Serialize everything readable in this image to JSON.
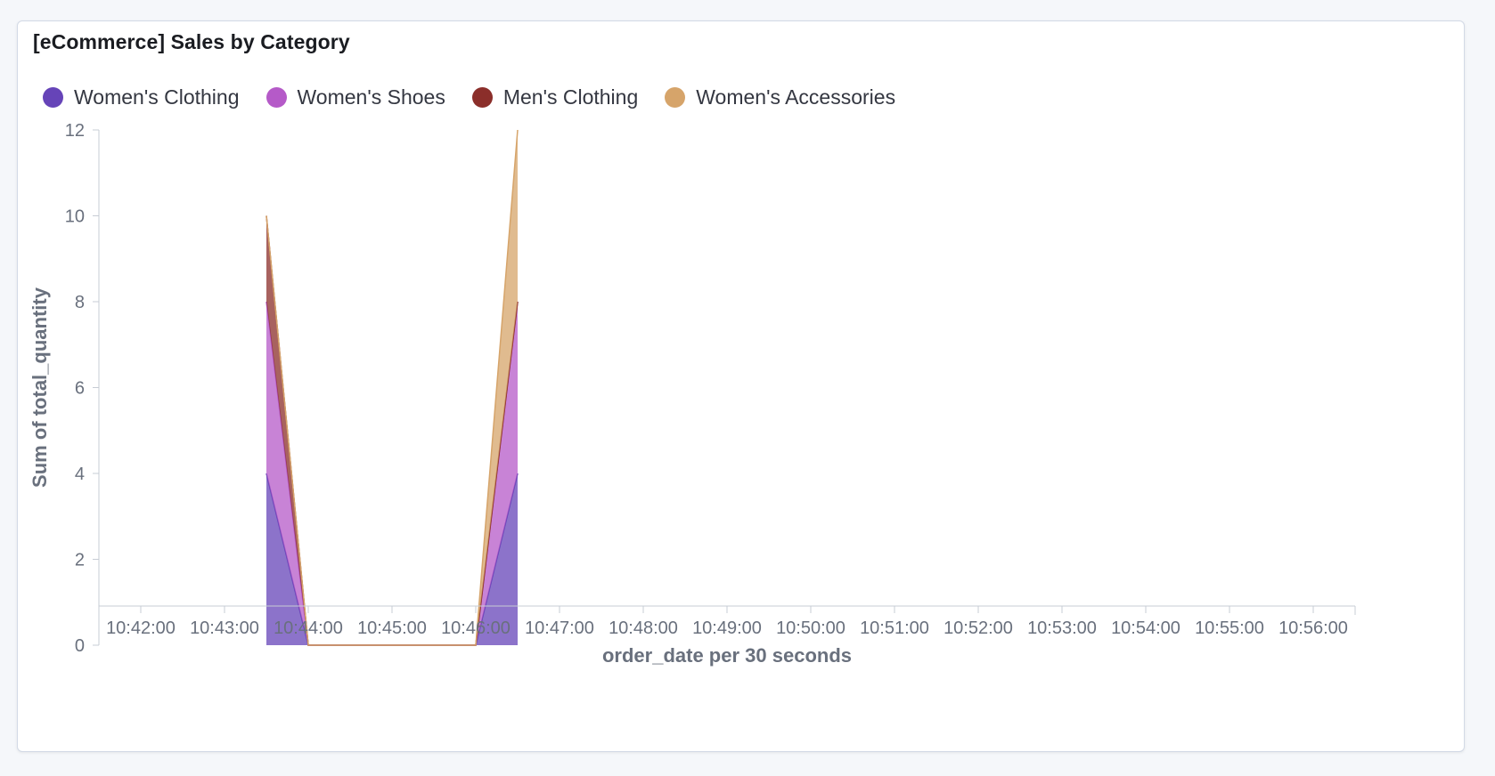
{
  "panel": {
    "title": "[eCommerce] Sales by Category"
  },
  "chart_data": {
    "type": "area",
    "stacked": true,
    "x": [
      "10:43:30",
      "10:44:00",
      "10:44:30",
      "10:45:00",
      "10:45:30",
      "10:46:00",
      "10:46:30"
    ],
    "series": [
      {
        "name": "Women's Clothing",
        "color": "#6644b8",
        "values": [
          4,
          0,
          0,
          0,
          0,
          0,
          4
        ]
      },
      {
        "name": "Women's Shoes",
        "color": "#b55ac8",
        "values": [
          4,
          0,
          0,
          0,
          0,
          0,
          4
        ]
      },
      {
        "name": "Men's Clothing",
        "color": "#8b2e2a",
        "values": [
          2,
          0,
          0,
          0,
          0,
          0,
          0
        ]
      },
      {
        "name": "Women's Accessories",
        "color": "#d6a46a",
        "values": [
          0,
          0,
          0,
          0,
          0,
          0,
          4
        ]
      }
    ],
    "xticks": [
      "10:42:00",
      "10:43:00",
      "10:44:00",
      "10:45:00",
      "10:46:00",
      "10:47:00",
      "10:48:00",
      "10:49:00",
      "10:50:00",
      "10:51:00",
      "10:52:00",
      "10:53:00",
      "10:54:00",
      "10:55:00",
      "10:56:00"
    ],
    "xlim": [
      "10:41:30",
      "10:56:30"
    ],
    "yticks": [
      "0",
      "2",
      "4",
      "6",
      "8",
      "10",
      "12"
    ],
    "ylim": [
      0,
      12
    ],
    "xlabel": "order_date per 30 seconds",
    "ylabel": "Sum of total_quantity",
    "legend_position": "top-left"
  }
}
